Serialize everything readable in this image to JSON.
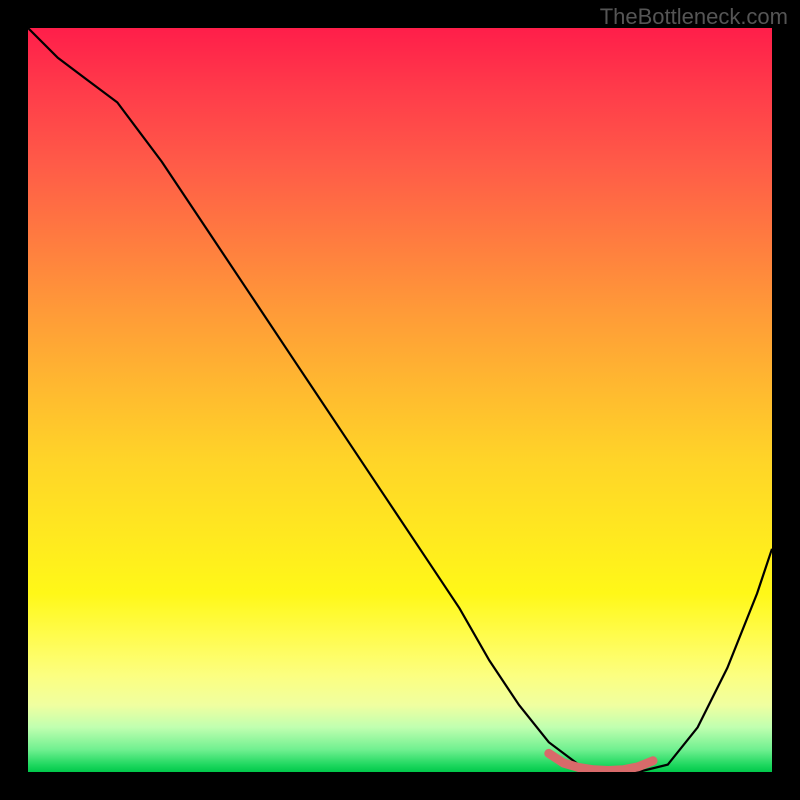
{
  "watermark": "TheBottleneck.com",
  "chart_data": {
    "type": "line",
    "title": "",
    "xlabel": "",
    "ylabel": "",
    "xlim": [
      0,
      100
    ],
    "ylim": [
      0,
      100
    ],
    "grid": false,
    "series": [
      {
        "name": "bottleneck-curve",
        "color": "#000000",
        "x": [
          0,
          4,
          8,
          12,
          18,
          24,
          30,
          36,
          42,
          48,
          54,
          58,
          62,
          66,
          70,
          74,
          78,
          82,
          86,
          90,
          94,
          98,
          100
        ],
        "y": [
          100,
          96,
          93,
          90,
          82,
          73,
          64,
          55,
          46,
          37,
          28,
          22,
          15,
          9,
          4,
          1,
          0,
          0,
          1,
          6,
          14,
          24,
          30
        ]
      },
      {
        "name": "optimal-highlight",
        "color": "#d86a6a",
        "x": [
          70,
          72,
          74,
          76,
          78,
          80,
          82,
          84
        ],
        "y": [
          2.5,
          1.2,
          0.6,
          0.3,
          0.2,
          0.3,
          0.7,
          1.5
        ]
      }
    ],
    "gradient_stops": [
      {
        "pos": 0,
        "color": "#ff1e4a"
      },
      {
        "pos": 8,
        "color": "#ff3a4a"
      },
      {
        "pos": 18,
        "color": "#ff5a48"
      },
      {
        "pos": 28,
        "color": "#ff7a40"
      },
      {
        "pos": 38,
        "color": "#ff9a38"
      },
      {
        "pos": 48,
        "color": "#ffb830"
      },
      {
        "pos": 58,
        "color": "#ffd428"
      },
      {
        "pos": 68,
        "color": "#ffe820"
      },
      {
        "pos": 76,
        "color": "#fff818"
      },
      {
        "pos": 82,
        "color": "#fffc50"
      },
      {
        "pos": 87,
        "color": "#fcff80"
      },
      {
        "pos": 91,
        "color": "#f0ffa0"
      },
      {
        "pos": 94,
        "color": "#c0ffb0"
      },
      {
        "pos": 97,
        "color": "#70f090"
      },
      {
        "pos": 99,
        "color": "#20d860"
      },
      {
        "pos": 100,
        "color": "#00c84a"
      }
    ]
  }
}
